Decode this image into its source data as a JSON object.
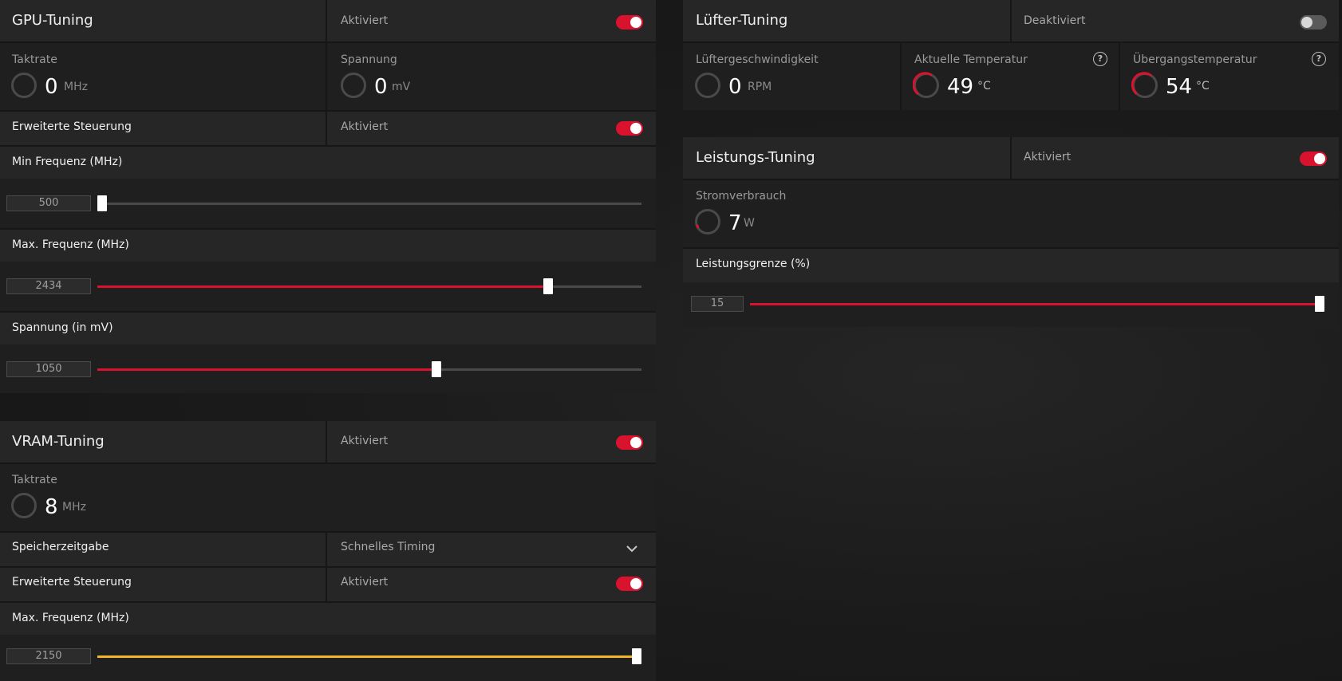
{
  "gpu": {
    "title": "GPU-Tuning",
    "status": "Aktiviert",
    "enabled": true,
    "clock_label": "Taktrate",
    "clock_value": "0",
    "clock_unit": "MHz",
    "voltage_label": "Spannung",
    "voltage_value": "0",
    "voltage_unit": "mV",
    "advanced_label": "Erweiterte Steuerung",
    "advanced_status": "Aktiviert",
    "advanced_enabled": true,
    "min_freq_label": "Min Frequenz (MHz)",
    "min_freq_value": "500",
    "min_freq_fraction": 0.0,
    "max_freq_label": "Max. Frequenz (MHz)",
    "max_freq_value": "2434",
    "max_freq_fraction": 0.835,
    "voltage_slider_label": "Spannung (in mV)",
    "voltage_slider_value": "1050",
    "voltage_slider_fraction": 0.625
  },
  "vram": {
    "title": "VRAM-Tuning",
    "status": "Aktiviert",
    "enabled": true,
    "clock_label": "Taktrate",
    "clock_value": "8",
    "clock_unit": "MHz",
    "timing_label": "Speicherzeitgabe",
    "timing_value": "Schnelles Timing",
    "advanced_label": "Erweiterte Steuerung",
    "advanced_status": "Aktiviert",
    "advanced_enabled": true,
    "max_freq_label": "Max. Frequenz (MHz)",
    "max_freq_value": "2150",
    "max_freq_fraction": 1.0
  },
  "fan": {
    "title": "Lüfter-Tuning",
    "status": "Deaktiviert",
    "enabled": false,
    "speed_label": "Lüftergeschwindigkeit",
    "speed_value": "0",
    "speed_unit": "RPM",
    "temp_label": "Aktuelle Temperatur",
    "temp_value": "49",
    "temp_unit": "°C",
    "junction_label": "Übergangstemperatur",
    "junction_value": "54",
    "junction_unit": "°C",
    "help_glyph": "?"
  },
  "power": {
    "title": "Leistungs-Tuning",
    "status": "Aktiviert",
    "enabled": true,
    "consumption_label": "Stromverbrauch",
    "consumption_value": "7",
    "consumption_unit": "W",
    "limit_label": "Leistungsgrenze (%)",
    "limit_value": "15",
    "limit_fraction": 1.0
  },
  "colors": {
    "accent_red": "#d9122e",
    "accent_yellow": "#f2b52a",
    "panel_bg": "#1f1f1f",
    "row_bg": "#262626"
  },
  "icons": [
    "gauge-icon",
    "help-circle-icon",
    "chevron-down-icon",
    "toggle-switch"
  ]
}
